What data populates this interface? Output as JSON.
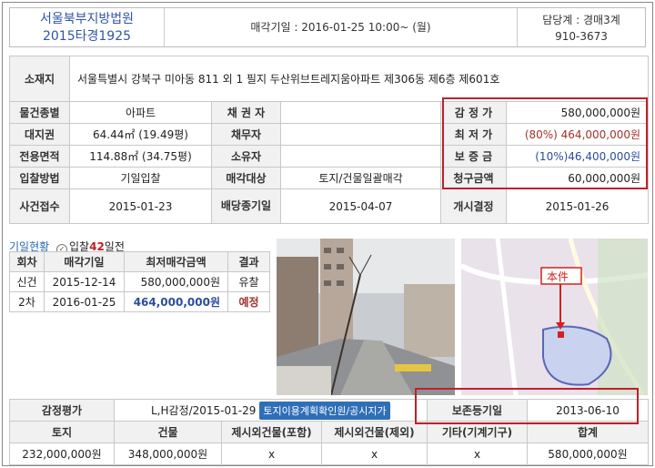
{
  "header": {
    "court": "서울북부지방법원",
    "case_no": "2015타경1925",
    "sale_date": "매각기일 : 2016-01-25   10:00~ (월)",
    "dept": "담당계 : 경매3계",
    "phone": "910-3673"
  },
  "info": {
    "address_label": "소재지",
    "address": "서울특별시 강북구 미아동 811 외 1 필지 두산위브트레지움아파트 제306동 제6층 제601호",
    "rows": [
      [
        "물건종별",
        "아파트",
        "채 권 자",
        "",
        "감 정 가",
        "580,000,000원"
      ],
      [
        "대지권",
        "64.44㎡ (19.49평)",
        "채무자",
        "",
        "최 저 가",
        "(80%) 464,000,000원"
      ],
      [
        "전용면적",
        "114.88㎡ (34.75평)",
        "소유자",
        "",
        "보 증 금",
        "(10%)46,400,000원"
      ],
      [
        "입찰방법",
        "기일입찰",
        "매각대상",
        "토지/건물일괄매각",
        "청구금액",
        "60,000,000원"
      ]
    ],
    "case_row": {
      "label1": "사건접수",
      "value1": "2015-01-23",
      "label2": "배당종기일",
      "value2": "2015-04-07",
      "label3": "개시결정",
      "value3": "2015-01-26"
    }
  },
  "history": {
    "title": "기일현황",
    "bid_prefix": "입찰",
    "bid_days": "42",
    "bid_suffix": "일전",
    "headers": [
      "회차",
      "매각기일",
      "최저매각금액",
      "결과"
    ],
    "rows": [
      [
        "신건",
        "2015-12-14",
        "580,000,000원",
        "유찰"
      ],
      [
        "2차",
        "2016-01-25",
        "464,000,000원",
        "예정"
      ]
    ]
  },
  "map": {
    "label": "本件"
  },
  "appraisal": {
    "label": "감정평가",
    "value": "L,H감정/2015-01-29",
    "button": "토지이용계획확인원/공시지가",
    "reg_label": "보존등기일",
    "reg_value": "2013-06-10",
    "headers": [
      "토지",
      "건물",
      "제시외건물(포함)",
      "제시외건물(제외)",
      "기타(기계기구)",
      "합계"
    ],
    "values": [
      "232,000,000원",
      "348,000,000원",
      "x",
      "x",
      "x",
      "580,000,000원"
    ]
  },
  "colors": {
    "accent_red": "#c0202a",
    "link_blue": "#2f56a8",
    "button_blue": "#2e6fb8"
  }
}
